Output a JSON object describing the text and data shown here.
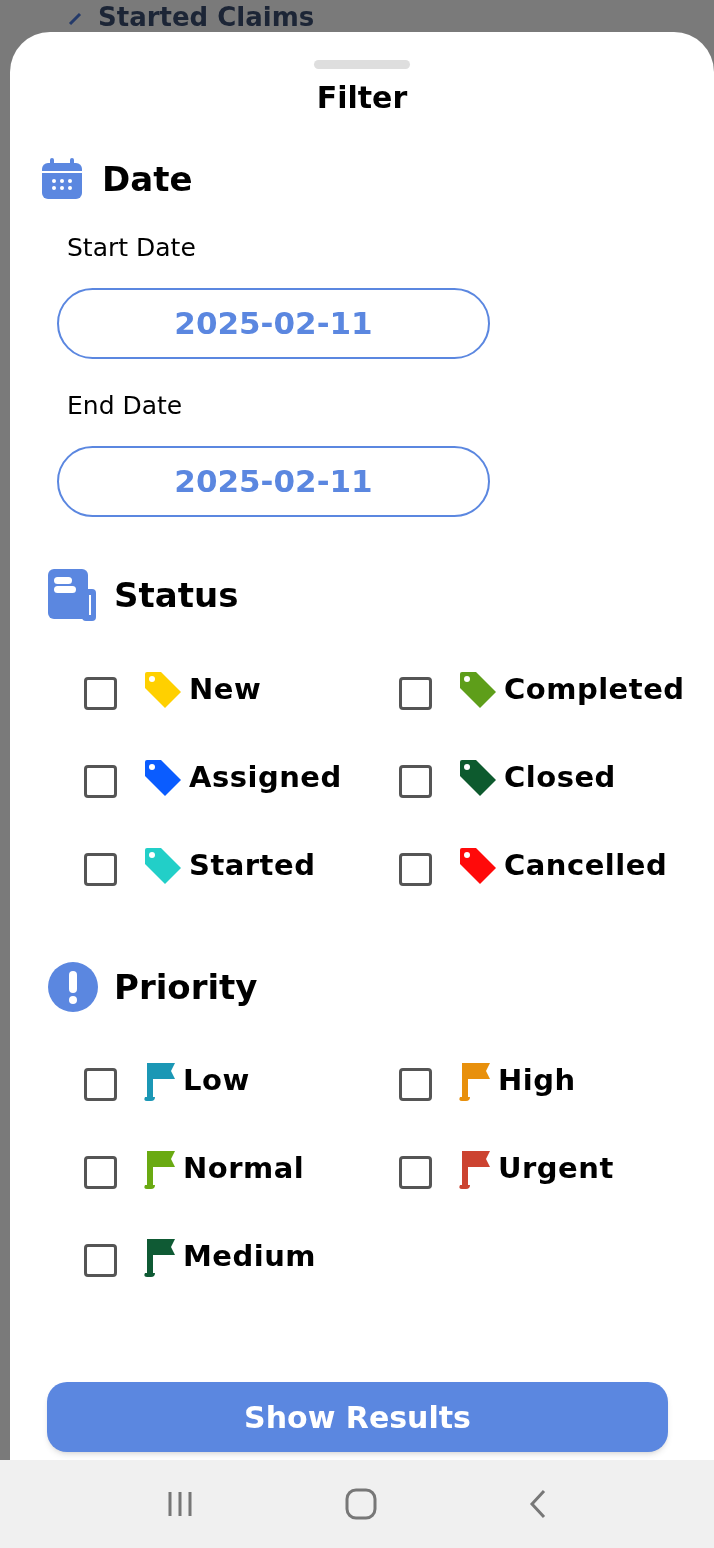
{
  "background": {
    "title": "Started Claims"
  },
  "sheet": {
    "title": "Filter",
    "date": {
      "heading": "Date",
      "fields": [
        {
          "label": "Start Date",
          "value": "2025-02-11"
        },
        {
          "label": "End Date",
          "value": "2025-02-11"
        }
      ]
    },
    "status": {
      "heading": "Status",
      "items": [
        {
          "label": "New",
          "checked": false,
          "color": "#ffd000"
        },
        {
          "label": "Completed",
          "checked": false,
          "color": "#5e9e1a"
        },
        {
          "label": "Assigned",
          "checked": false,
          "color": "#0a5cff"
        },
        {
          "label": "Closed",
          "checked": false,
          "color": "#0d5a2e"
        },
        {
          "label": "Started",
          "checked": false,
          "color": "#22cfc8"
        },
        {
          "label": "Cancelled",
          "checked": false,
          "color": "#ff0a0a"
        }
      ]
    },
    "priority": {
      "heading": "Priority",
      "items": [
        {
          "label": "Low",
          "checked": false,
          "color": "#1b97b5"
        },
        {
          "label": "High",
          "checked": false,
          "color": "#e8900c"
        },
        {
          "label": "Normal",
          "checked": false,
          "color": "#6aaa12"
        },
        {
          "label": "Urgent",
          "checked": false,
          "color": "#cc4330"
        },
        {
          "label": "Medium",
          "checked": false,
          "color": "#0f5a34"
        }
      ]
    },
    "button": "Show Results"
  }
}
